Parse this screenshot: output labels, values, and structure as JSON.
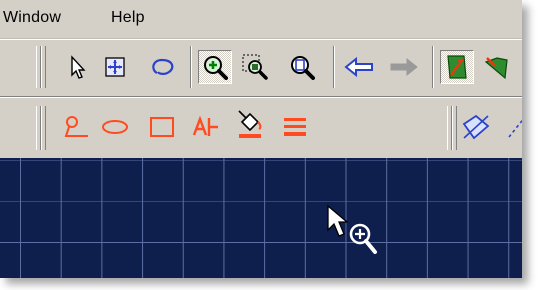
{
  "menubar": {
    "items": [
      {
        "label": "Window"
      },
      {
        "label": "Help"
      }
    ]
  },
  "toolbar1": {
    "buttons": [
      {
        "icon": "arrow-select-icon"
      },
      {
        "icon": "frame-select-icon"
      },
      {
        "icon": "lasso-icon"
      },
      {
        "icon": "zoom-in-icon",
        "pressed": true
      },
      {
        "icon": "zoom-window-icon"
      },
      {
        "icon": "zoom-extents-icon"
      },
      {
        "icon": "back-arrow-icon"
      },
      {
        "icon": "forward-arrow-icon",
        "disabled": true
      },
      {
        "icon": "green-arrow-tool-icon",
        "pressed": true
      },
      {
        "icon": "green-shape-tool-icon"
      }
    ]
  },
  "toolbar2": {
    "buttons": [
      {
        "icon": "polyline-icon"
      },
      {
        "icon": "ellipse-icon"
      },
      {
        "icon": "rectangle-icon"
      },
      {
        "icon": "text-icon"
      },
      {
        "icon": "paint-bucket-icon"
      },
      {
        "icon": "line-width-icon"
      },
      {
        "icon": "blue-shape-icon"
      },
      {
        "icon": "dashed-line-icon"
      }
    ]
  },
  "colors": {
    "chrome": "#d4d0c8",
    "canvas": "#0e1f4d",
    "grid": "#5b6fa2",
    "drawTool": "#ff4b1f"
  }
}
